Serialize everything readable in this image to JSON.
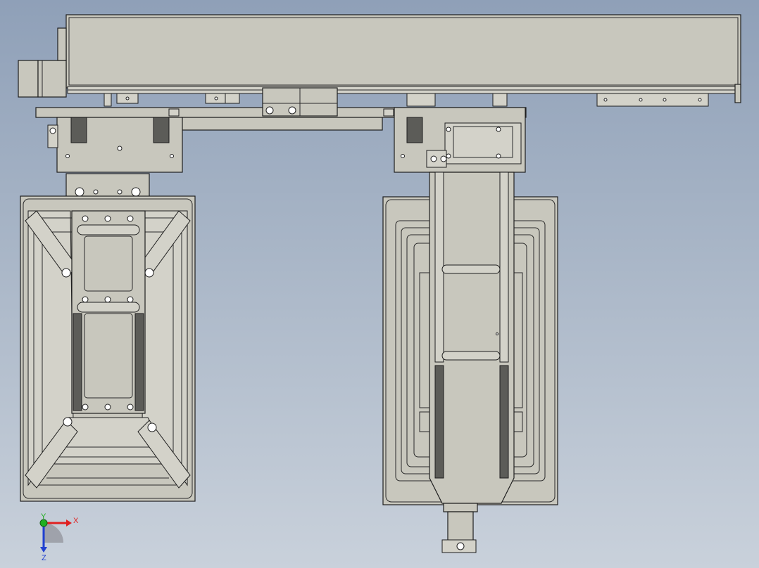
{
  "viewport": {
    "background_top": "#8fa0b8",
    "background_bottom": "#c9d1db",
    "part_fill": "#c8c7bd",
    "part_stroke": "#1e1e1e",
    "rail_dark": "#5c5c58"
  },
  "triad": {
    "x_label": "X",
    "y_label": "Y",
    "z_label": "Z",
    "x_color": "#e02020",
    "y_color": "#20b020",
    "z_color": "#2040d0"
  }
}
